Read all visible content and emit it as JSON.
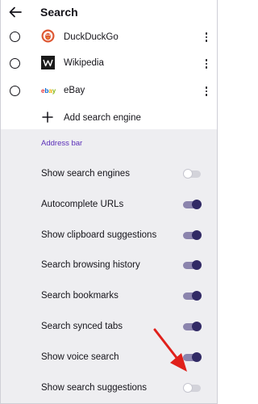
{
  "app_bar": {
    "title": "Search",
    "back_icon": "arrow-left-icon"
  },
  "search_engines": [
    {
      "name": "DuckDuckGo",
      "logo": "duckduckgo-logo",
      "selected": false
    },
    {
      "name": "Wikipedia",
      "logo": "wikipedia-logo",
      "selected": false
    },
    {
      "name": "eBay",
      "logo": "ebay-logo",
      "selected": false
    }
  ],
  "add_engine": {
    "label": "Add search engine",
    "icon": "plus-icon"
  },
  "address_bar": {
    "section_label": "Address bar",
    "settings": [
      {
        "label": "Show search engines",
        "enabled": false
      },
      {
        "label": "Autocomplete URLs",
        "enabled": true
      },
      {
        "label": "Show clipboard suggestions",
        "enabled": true
      },
      {
        "label": "Search browsing history",
        "enabled": true
      },
      {
        "label": "Search bookmarks",
        "enabled": true
      },
      {
        "label": "Search synced tabs",
        "enabled": true
      },
      {
        "label": "Show voice search",
        "enabled": true
      },
      {
        "label": "Show search suggestions",
        "enabled": false
      }
    ]
  },
  "colors": {
    "accent": "#5b2fb8",
    "toggle_on_knob": "#312a65",
    "toggle_on_track": "#8b84ad",
    "annotation_arrow": "#e0201b",
    "settings_background": "#eeeef1"
  }
}
